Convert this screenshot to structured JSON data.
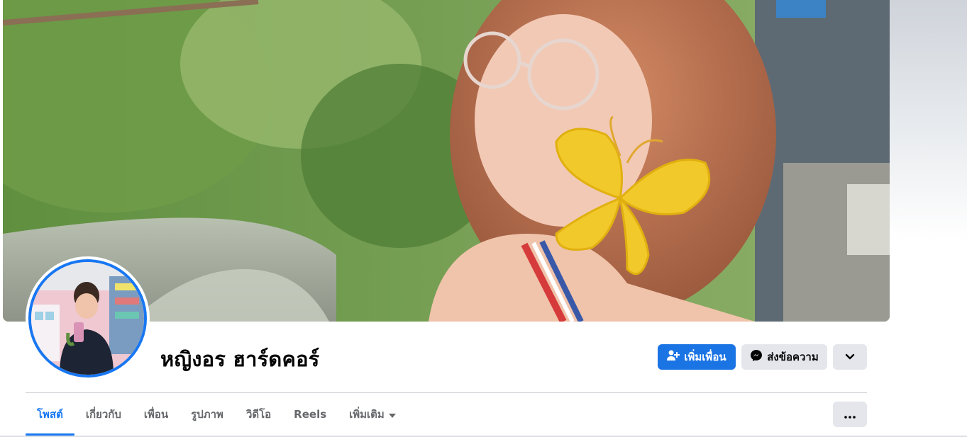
{
  "profile": {
    "name": "หญิงอร ฮาร์ดคอร์"
  },
  "actions": {
    "add_friend_label": "เพิ่มเพื่อน",
    "message_label": "ส่งข้อความ"
  },
  "tabs": [
    {
      "label": "โพสต์",
      "active": true
    },
    {
      "label": "เกี่ยวกับ",
      "active": false
    },
    {
      "label": "เพื่อน",
      "active": false
    },
    {
      "label": "รูปภาพ",
      "active": false
    },
    {
      "label": "วิดีโอ",
      "active": false
    },
    {
      "label": "Reels",
      "active": false
    },
    {
      "label": "เพิ่มเติม",
      "active": false
    }
  ],
  "colors": {
    "accent": "#1877f2",
    "button_secondary": "#e4e6eb",
    "text_primary": "#050505",
    "text_secondary": "#65676b"
  },
  "icons": {
    "add_friend": "person-plus-icon",
    "message": "messenger-icon",
    "more": "chevron-down-icon",
    "tab_more": "caret-down-icon",
    "options": "ellipsis-icon"
  }
}
